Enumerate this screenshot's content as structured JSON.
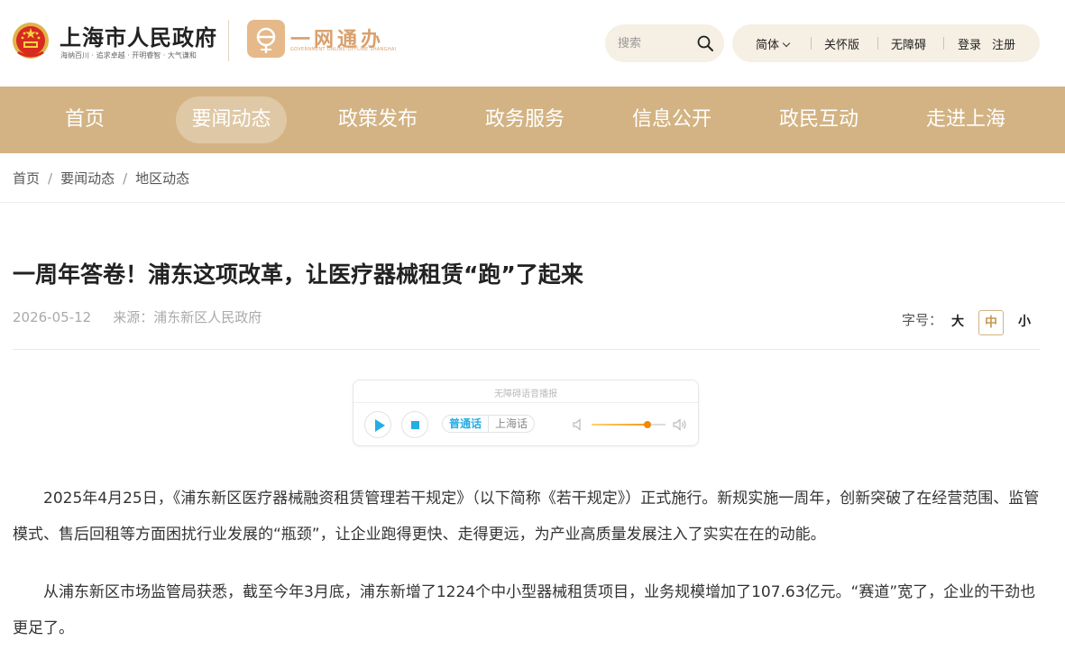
{
  "header": {
    "site_title": "上海市人民政府",
    "site_slogan": "海纳百川 · 追求卓越 · 开明睿智 · 大气谦和",
    "yiwang_title": "一网通办",
    "yiwang_subtitle": "GOVERNMENT ONLINE-OFFLINE SHANGHAI",
    "search": {
      "placeholder": "搜索"
    },
    "utils": {
      "language": "简体",
      "care": "关怀版",
      "accessible": "无障碍",
      "login": "登录",
      "register": "注册"
    }
  },
  "nav": {
    "items": [
      {
        "label": "首页"
      },
      {
        "label": "要闻动态",
        "active": true
      },
      {
        "label": "政策发布"
      },
      {
        "label": "政务服务"
      },
      {
        "label": "信息公开"
      },
      {
        "label": "政民互动"
      },
      {
        "label": "走进上海"
      }
    ]
  },
  "breadcrumb": {
    "items": [
      "首页",
      "要闻动态",
      "地区动态"
    ],
    "separator": "/"
  },
  "article": {
    "title": "一周年答卷！浦东这项改革，让医疗器械租赁“跑”了起来",
    "date": "2026-05-12",
    "source": "来源：浦东新区人民政府",
    "font_size_label": "字号：",
    "font_sizes": {
      "large": "大",
      "medium": "中",
      "small": "小",
      "selected": "中"
    },
    "paragraphs": [
      "2025年4月25日，《浦东新区医疗器械融资租赁管理若干规定》（以下简称《若干规定》）正式施行。新规实施一周年，创新突破了在经营范围、监管模式、售后回租等方面困扰行业发展的“瓶颈”，让企业跑得更快、走得更远，为产业高质量发展注入了实实在在的动能。",
      "从浦东新区市场监管局获悉，截至今年3月底，浦东新增了1224个中小型器械租赁项目，业务规模增加了107.63亿元。“赛道”宽了，企业的干劲也更足了。"
    ]
  },
  "player": {
    "label": "无障碍语音播报",
    "languages": [
      "普通话",
      "上海话"
    ],
    "selected_language": "普通话",
    "volume": 0.75
  },
  "colors": {
    "nav_background": "#d3b383",
    "accent_gold": "#c59a55",
    "player_blue": "#23aee5",
    "volume_orange": "#f08a00"
  }
}
